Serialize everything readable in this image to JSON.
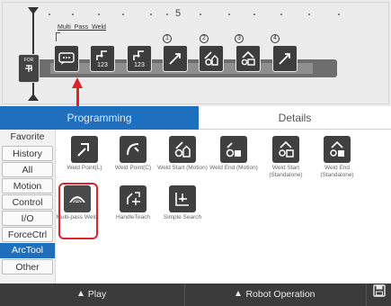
{
  "timeline": {
    "marker_number": "5",
    "group_label": "Multi_Pass_Weld",
    "for_block": {
      "label": "FOR",
      "icon": "loop-enter-icon"
    },
    "blocks": [
      {
        "icon": "comment-icon",
        "number": ""
      },
      {
        "icon": "robot-arm-icon",
        "number": "123"
      },
      {
        "icon": "robot-arm-icon",
        "number": "123"
      },
      {
        "icon": "weld-point-icon",
        "number": "",
        "badge": "1"
      },
      {
        "icon": "weld-start-motion-icon",
        "number": "",
        "badge": "2"
      },
      {
        "icon": "weld-end-standalone-icon",
        "number": "",
        "badge": "3"
      },
      {
        "icon": "weld-point-icon",
        "number": "",
        "badge": "4"
      }
    ]
  },
  "tabs": [
    {
      "label": "Programming",
      "active": true
    },
    {
      "label": "Details",
      "active": false
    }
  ],
  "sidebar": {
    "items": [
      {
        "label": "Favorite"
      },
      {
        "label": "History"
      },
      {
        "label": "All"
      },
      {
        "label": "Motion"
      },
      {
        "label": "Control"
      },
      {
        "label": "I/O"
      },
      {
        "label": "ForceCtrl"
      },
      {
        "label": "ArcTool"
      },
      {
        "label": "Other"
      }
    ],
    "active_index": 7
  },
  "tools": {
    "row1": [
      {
        "label": "Weld Point(L)",
        "icon": "weld-point-linear-icon"
      },
      {
        "label": "Weld Point(C)",
        "icon": "weld-point-circular-icon"
      },
      {
        "label": "Weld Start (Motion)",
        "icon": "weld-start-motion-icon"
      },
      {
        "label": "Weld End (Motion)",
        "icon": "weld-end-motion-icon"
      },
      {
        "label": "Weld Start (Standalone)",
        "icon": "weld-start-standalone-icon"
      },
      {
        "label": "Weld End (Standalone)",
        "icon": "weld-end-standalone-icon"
      }
    ],
    "row2": [
      {
        "label": "Multi-pass Weld",
        "icon": "multi-pass-weld-icon"
      },
      {
        "label": "HandleTeach",
        "icon": "handle-teach-icon"
      },
      {
        "label": "Simple Search",
        "icon": "simple-search-icon"
      }
    ]
  },
  "bottom_bar": {
    "play_label": "Play",
    "robot_label": "Robot Operation",
    "save_icon": "save-icon"
  },
  "colors": {
    "accent": "#1e6fbd",
    "highlight": "#d9262c",
    "block": "#3d3d3d",
    "bar": "#3b3b3b"
  }
}
